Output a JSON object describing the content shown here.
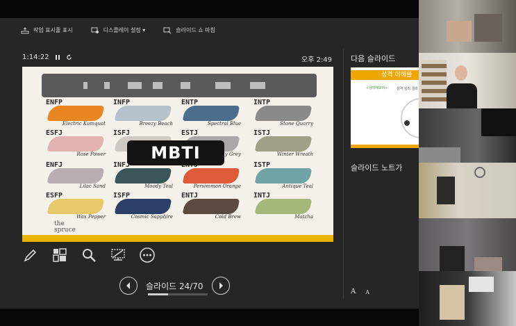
{
  "toolbar": {
    "taskbar_label": "작업 표시줄 표시",
    "display_label": "디스플레이 설정 ▾",
    "end_show_label": "슬라이드 쇼 마침"
  },
  "timer": {
    "elapsed": "1:14:22"
  },
  "clock": {
    "time": "오후 2:49"
  },
  "next_slide": {
    "label": "다음 슬라이드",
    "title": "성격 이해를",
    "tag": "<생각해보자>",
    "subtitle": "성격 심리 결과"
  },
  "notes": {
    "label": "슬라이드 노트가"
  },
  "current_slide": {
    "badge": "MBTI",
    "logo_line1": "the",
    "logo_line2": "spruce",
    "swatches": [
      {
        "type": "ENFP",
        "name": "Electric Kumquat",
        "color": "#e9861f"
      },
      {
        "type": "INFP",
        "name": "Breezy Beach",
        "color": "#b5c2cb"
      },
      {
        "type": "ENTP",
        "name": "Spectral Blue",
        "color": "#4d6d8c"
      },
      {
        "type": "INTP",
        "name": "Stone Quarry",
        "color": "#8a8a86"
      },
      {
        "type": "ESFJ",
        "name": "Rose Power",
        "color": "#e1b3b1"
      },
      {
        "type": "ISFJ",
        "name": "",
        "color": "#cfc9c5"
      },
      {
        "type": "ESTJ",
        "name": "Silly Grey",
        "color": "#a9a8a6"
      },
      {
        "type": "ISTJ",
        "name": "Winter Wreath",
        "color": "#a19f86"
      },
      {
        "type": "ENFJ",
        "name": "Lilac Sand",
        "color": "#b8adb1"
      },
      {
        "type": "INFJ",
        "name": "Moody Teal",
        "color": "#3b5658"
      },
      {
        "type": "ENTJ",
        "name": "Persimmon Orange",
        "color": "#de5a38"
      },
      {
        "type": "ISTP",
        "name": "Antique Teal",
        "color": "#70a3a3"
      },
      {
        "type": "ESFP",
        "name": "Wax Pepper",
        "color": "#e6c96a"
      },
      {
        "type": "ISFP",
        "name": "Cosmic Sapphire",
        "color": "#2c3f66"
      },
      {
        "type": "ENTJ",
        "name": "Cold Brew",
        "color": "#5a4a40"
      },
      {
        "type": "INTJ",
        "name": "Matcha",
        "color": "#a6b77a"
      }
    ]
  },
  "navigation": {
    "slide_counter": "슬라이드 24/70",
    "progress_fraction": 0.34
  },
  "font_buttons": {
    "increase": "A",
    "decrease": "A"
  },
  "colors": {
    "accent": "#e8b400",
    "presenter_bg": "#262626"
  }
}
